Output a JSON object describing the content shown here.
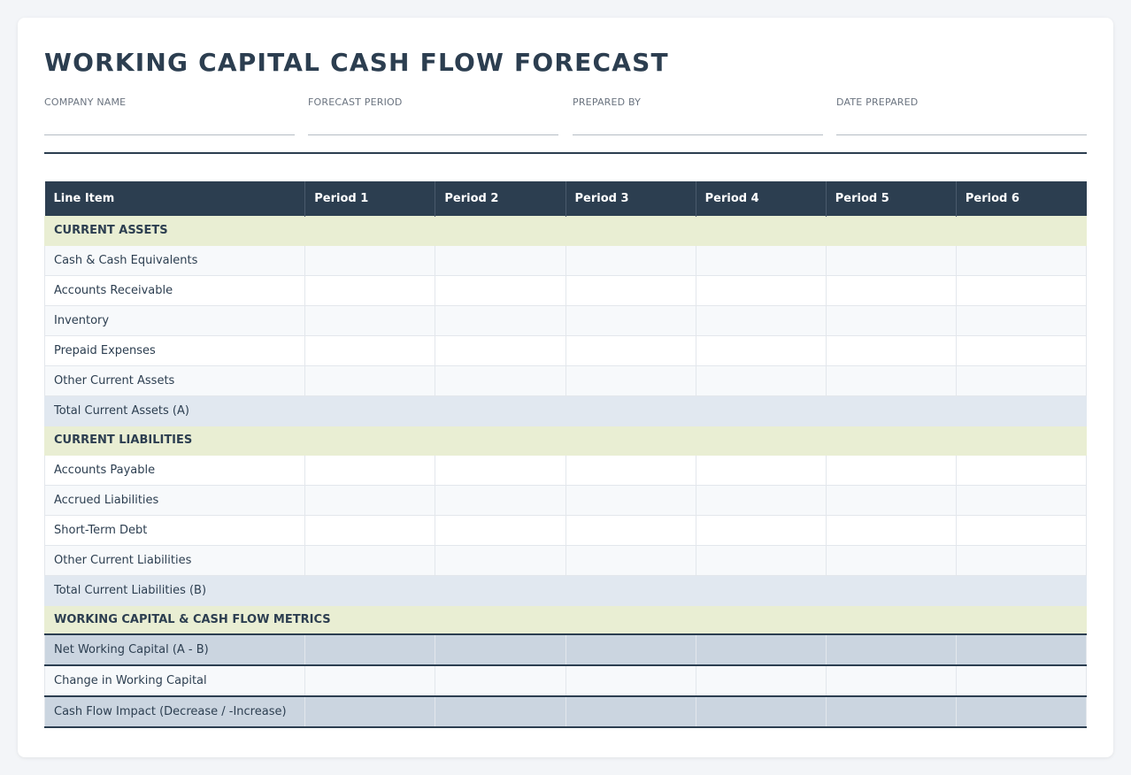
{
  "title": "WORKING CAPITAL CASH FLOW FORECAST",
  "meta": [
    {
      "label": "COMPANY NAME",
      "value": ""
    },
    {
      "label": "FORECAST PERIOD",
      "value": ""
    },
    {
      "label": "PREPARED BY",
      "value": ""
    },
    {
      "label": "DATE PREPARED",
      "value": ""
    }
  ],
  "table": {
    "headers": [
      "Line Item",
      "Period 1",
      "Period 2",
      "Period 3",
      "Period 4",
      "Period 5",
      "Period 6"
    ],
    "sections": {
      "assets": "CURRENT ASSETS",
      "liabilities": "CURRENT LIABILITIES",
      "metrics": "WORKING CAPITAL & CASH FLOW METRICS"
    },
    "asset_rows": [
      "Cash & Cash Equivalents",
      "Accounts Receivable",
      "Inventory",
      "Prepaid Expenses",
      "Other Current Assets"
    ],
    "total_assets": "Total Current Assets (A)",
    "liability_rows": [
      "Accounts Payable",
      "Accrued Liabilities",
      "Short-Term Debt",
      "Other Current Liabilities"
    ],
    "total_liabilities": "Total Current Liabilities (B)",
    "metric_rows": [
      "Net Working Capital (A - B)",
      "Change in Working Capital",
      "Cash Flow Impact (Decrease / -Increase)"
    ]
  },
  "colors": {
    "header_bg": "#2c3e50",
    "section_bg": "#e9eed3",
    "total_bg": "#e1e8f0",
    "metric_bg": "#cbd5e0"
  }
}
